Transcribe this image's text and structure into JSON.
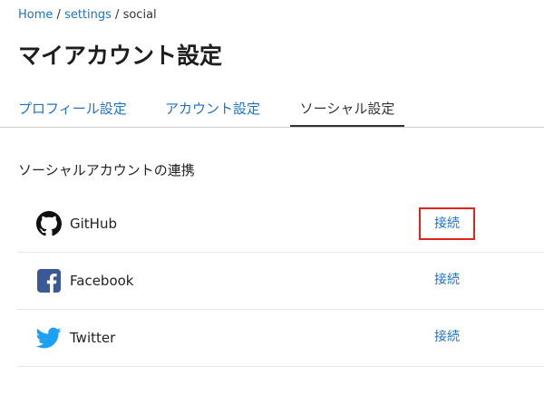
{
  "breadcrumb": {
    "home": "Home",
    "settings": "settings",
    "current": "social",
    "separator": "/"
  },
  "page": {
    "title": "マイアカウント設定"
  },
  "tabs": [
    {
      "label": "プロフィール設定"
    },
    {
      "label": "アカウント設定"
    },
    {
      "label": "ソーシャル設定"
    }
  ],
  "section": {
    "heading": "ソーシャルアカウントの連携"
  },
  "accounts": [
    {
      "name": "GitHub",
      "icon": "github-icon",
      "action": "接続"
    },
    {
      "name": "Facebook",
      "icon": "facebook-icon",
      "action": "接続"
    },
    {
      "name": "Twitter",
      "icon": "twitter-icon",
      "action": "接続"
    }
  ],
  "colors": {
    "link": "#1a73c8",
    "highlight": "#e0241b",
    "facebook": "#3b5998",
    "twitter": "#1da1f2"
  }
}
